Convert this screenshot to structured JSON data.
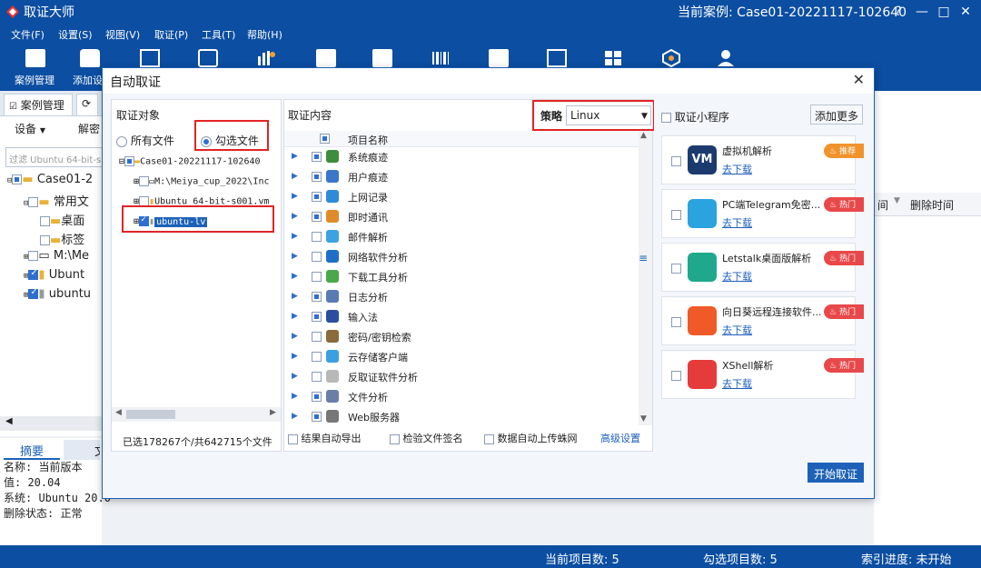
{
  "app": {
    "title": "取证大师",
    "current_case": "当前案例: Case01-20221117-102640"
  },
  "window_controls": {
    "help": "?",
    "minimize": "—",
    "maximize": "□",
    "close": "✕"
  },
  "menu": [
    "文件(F)",
    "设置(S)",
    "视图(V)",
    "取证(P)",
    "工具(T)",
    "帮助(H)"
  ],
  "toolbar": {
    "labels": [
      "案例管理",
      "添加设"
    ]
  },
  "left": {
    "tabs": [
      "案例管理",
      "⟳"
    ],
    "device_btn": "设备",
    "decrypt_btn": "解密",
    "filter_placeholder": "过滤 Ubuntu 64-bit-s",
    "tree": [
      "Case01-2",
      "常用文",
      "桌面",
      "标签",
      "M:\\Me",
      "Ubunt",
      "ubuntu"
    ],
    "bottom_tabs": [
      "摘要",
      "文"
    ],
    "details": [
      "名称: 当前版本",
      "值: 20.04",
      "系统: Ubuntu 20.0",
      "删除状态: 正常"
    ]
  },
  "right_cols": {
    "col1": "间",
    "col2": "删除时间"
  },
  "dialog": {
    "title": "自动取证",
    "close": "✕",
    "target": {
      "header": "取证对象",
      "radio_all": "所有文件",
      "radio_checked": "勾选文件",
      "tree": [
        "Case01-20221117-102640",
        "M:\\Meiya_cup_2022\\Inc",
        "Ubuntu 64-bit-s001.vm",
        "ubuntu-lv"
      ],
      "status": "已选178267个/共642715个文件"
    },
    "content": {
      "header": "取证内容",
      "strategy_label": "策略",
      "strategy_value": "Linux",
      "col_header": "项目名称",
      "items": [
        {
          "label": "系统痕迹",
          "checked": true,
          "color": "#3c8d3c"
        },
        {
          "label": "用户痕迹",
          "checked": true,
          "color": "#3a76c9"
        },
        {
          "label": "上网记录",
          "checked": true,
          "color": "#2e8bd8"
        },
        {
          "label": "即时通讯",
          "checked": true,
          "color": "#e08b2a"
        },
        {
          "label": "邮件解析",
          "checked": false,
          "color": "#3aa3e0"
        },
        {
          "label": "网络软件分析",
          "checked": false,
          "color": "#1f6fc7"
        },
        {
          "label": "下载工具分析",
          "checked": false,
          "color": "#4aa84a"
        },
        {
          "label": "日志分析",
          "checked": true,
          "color": "#5a7ab5"
        },
        {
          "label": "输入法",
          "checked": true,
          "color": "#2a4f9c"
        },
        {
          "label": "密码/密钥检索",
          "checked": false,
          "color": "#8a6b3a"
        },
        {
          "label": "云存储客户端",
          "checked": false,
          "color": "#3aa0e0"
        },
        {
          "label": "反取证软件分析",
          "checked": false,
          "color": "#b8b8b8"
        },
        {
          "label": "文件分析",
          "checked": true,
          "color": "#6a7ea8"
        },
        {
          "label": "Web服务器",
          "checked": true,
          "color": "#777777"
        }
      ],
      "opt_export": "结果自动导出",
      "opt_sign": "检验文件签名",
      "opt_upload": "数据自动上传蛛网",
      "advanced": "高级设置"
    },
    "mini": {
      "header": "取证小程序",
      "add_more": "添加更多",
      "download": "去下载",
      "cards": [
        {
          "name": "虚拟机解析",
          "badge": "推荐",
          "color": "#1b3b6f",
          "icon_text": "VM"
        },
        {
          "name": "PC端Telegram免密...",
          "badge": "热门",
          "color": "#2aa3df",
          "icon_text": ""
        },
        {
          "name": "Letstalk桌面版解析",
          "badge": "热门",
          "color": "#1fa88c",
          "icon_text": ""
        },
        {
          "name": "向日葵远程连接软件...",
          "badge": "热门",
          "color": "#f05a28",
          "icon_text": ""
        },
        {
          "name": "XShell解析",
          "badge": "热门",
          "color": "#e63b3b",
          "icon_text": ""
        }
      ]
    },
    "start_btn": "开始取证"
  },
  "status": {
    "current": "当前项目数: 5",
    "checked": "勾选项目数: 5",
    "index": "索引进度: 未开始"
  }
}
